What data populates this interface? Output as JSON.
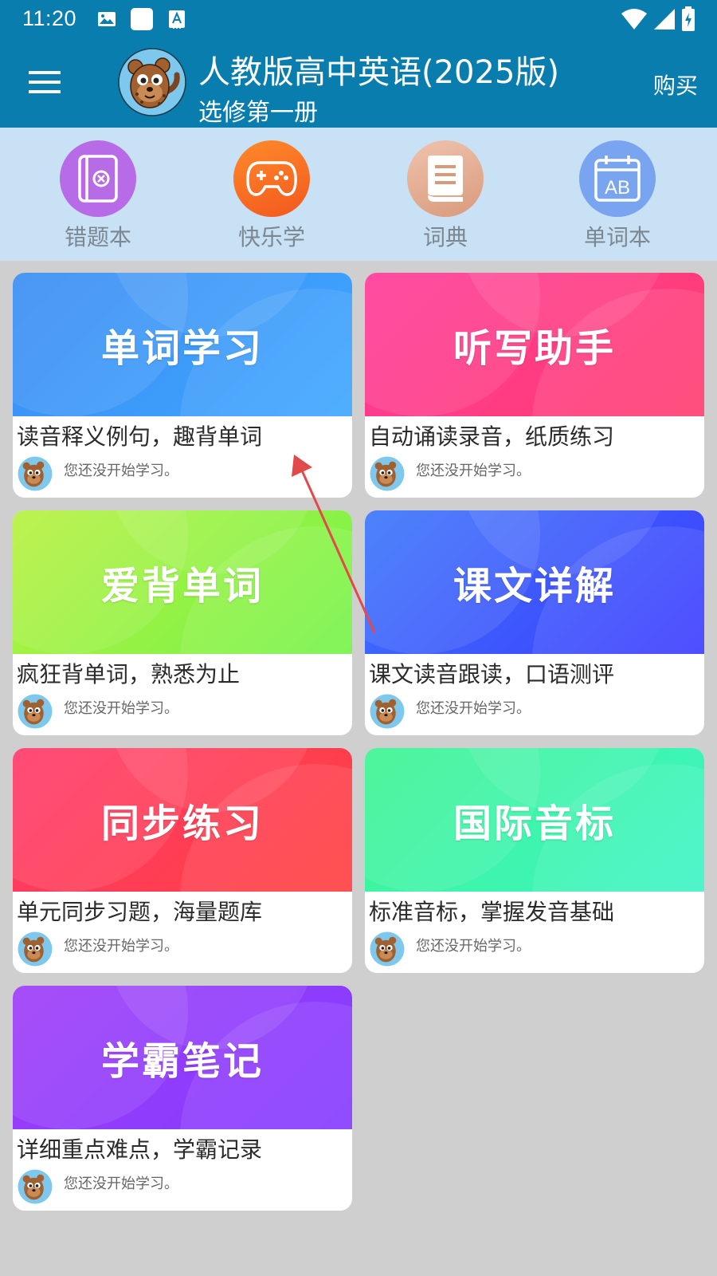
{
  "status_bar": {
    "time": "11:20"
  },
  "header": {
    "title": "人教版高中英语(2025版)",
    "subtitle": "选修第一册",
    "buy_label": "购买",
    "color": "#097dad"
  },
  "quick_menu": {
    "background": "#c8e1f4",
    "items": [
      {
        "label": "错题本",
        "icon": "notebook-x-icon",
        "color": "#b86be6"
      },
      {
        "label": "快乐学",
        "icon": "gamepad-icon",
        "color": "#f26a22"
      },
      {
        "label": "词典",
        "icon": "book-icon",
        "color": "#e7a88e"
      },
      {
        "label": "单词本",
        "icon": "calendar-ab-icon",
        "color": "#79a4ef"
      }
    ]
  },
  "modules": [
    {
      "title": "单词学习",
      "description": "读音释义例句，趣背单词",
      "status": "您还没开始学习。",
      "color_a": "#3a8cf3",
      "color_b": "#3fa7ff"
    },
    {
      "title": "听写助手",
      "description": "自动诵读录音，纸质练习",
      "status": "您还没开始学习。",
      "color_a": "#ff3a99",
      "color_b": "#ff3e70"
    },
    {
      "title": "爱背单词",
      "description": "疯狂背单词，熟悉为止",
      "status": "您还没开始学习。",
      "color_a": "#b7f13f",
      "color_b": "#75f34a"
    },
    {
      "title": "课文详解",
      "description": "课文读音跟读，口语测评",
      "status": "您还没开始学习。",
      "color_a": "#3c76fb",
      "color_b": "#3e3dfe"
    },
    {
      "title": "同步练习",
      "description": "单元同步习题，海量题库",
      "status": "您还没开始学习。",
      "color_a": "#ff3a6a",
      "color_b": "#ff4040"
    },
    {
      "title": "国际音标",
      "description": "标准音标，掌握发音基础",
      "status": "您还没开始学习。",
      "color_a": "#3cf591",
      "color_b": "#3ef5c6"
    },
    {
      "title": "学霸笔记",
      "description": "详细重点难点，学霸记录",
      "status": "您还没开始学习。",
      "color_a": "#9d3cf8",
      "color_b": "#853cff"
    }
  ]
}
